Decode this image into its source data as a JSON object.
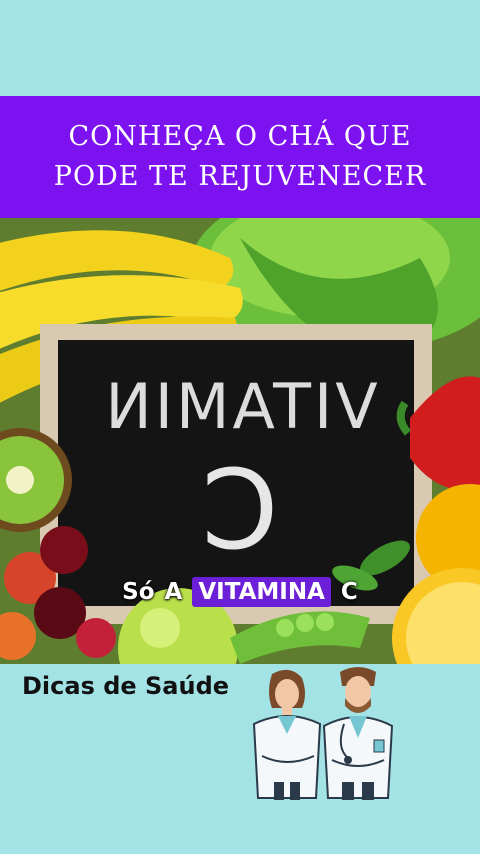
{
  "banner": {
    "line1": "CONHEÇA O CHÁ QUE",
    "line2": "PODE TE REJUVENECER"
  },
  "board": {
    "text_line1": "VITAMIN",
    "text_line2": "C"
  },
  "caption": {
    "word1": "Só",
    "word2": "A",
    "word3": "VITAMINA",
    "word4": "C"
  },
  "footer": {
    "title": "Dicas de Saúde"
  },
  "colors": {
    "background": "#a3e3e6",
    "banner": "#7d12f0",
    "caption_highlight": "#6b1fd6"
  }
}
